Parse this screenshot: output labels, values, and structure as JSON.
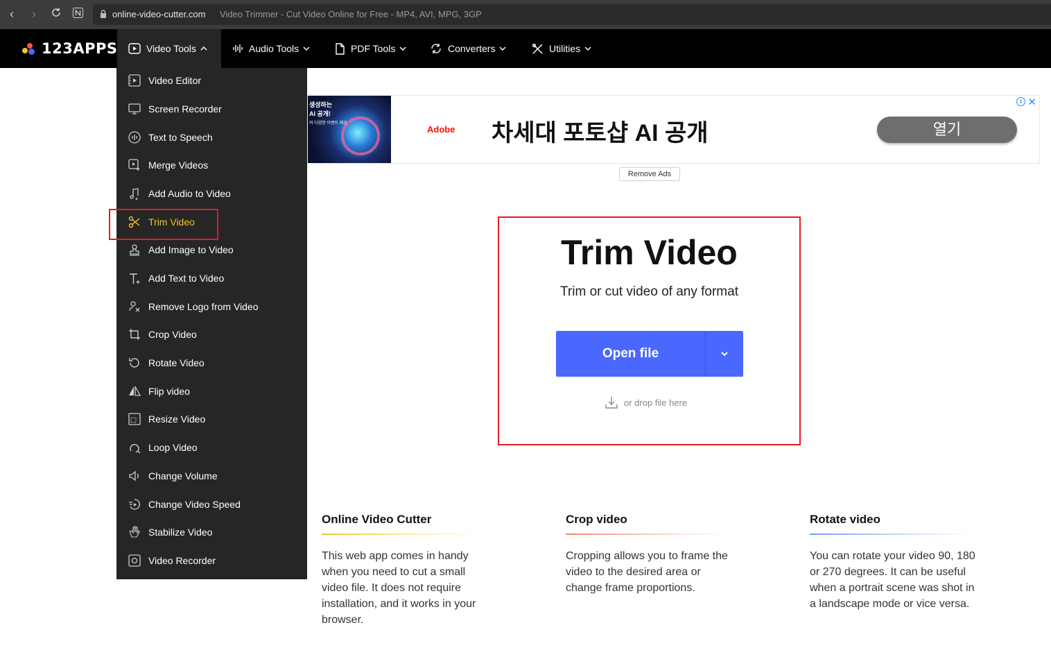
{
  "browser": {
    "host": "online-video-cutter.com",
    "page_title": "Video Trimmer - Cut Video Online for Free - MP4, AVI, MPG, 3GP"
  },
  "logo": {
    "text": "123APPS"
  },
  "nav": {
    "video_tools": "Video Tools",
    "audio_tools": "Audio Tools",
    "pdf_tools": "PDF Tools",
    "converters": "Converters",
    "utilities": "Utilities"
  },
  "menu": {
    "items": [
      {
        "label": "Video Editor",
        "icon": "video-editor-icon"
      },
      {
        "label": "Screen Recorder",
        "icon": "monitor-icon"
      },
      {
        "label": "Text to Speech",
        "icon": "speech-icon"
      },
      {
        "label": "Merge Videos",
        "icon": "merge-icon"
      },
      {
        "label": "Add Audio to Video",
        "icon": "music-note-icon"
      },
      {
        "label": "Trim Video",
        "icon": "scissors-icon",
        "selected": true
      },
      {
        "label": "Add Image to Video",
        "icon": "stamp-icon"
      },
      {
        "label": "Add Text to Video",
        "icon": "text-icon"
      },
      {
        "label": "Remove Logo from Video",
        "icon": "remove-logo-icon"
      },
      {
        "label": "Crop Video",
        "icon": "crop-icon"
      },
      {
        "label": "Rotate Video",
        "icon": "rotate-icon"
      },
      {
        "label": "Flip video",
        "icon": "flip-icon"
      },
      {
        "label": "Resize Video",
        "icon": "resize-icon"
      },
      {
        "label": "Loop Video",
        "icon": "loop-icon"
      },
      {
        "label": "Change Volume",
        "icon": "volume-icon"
      },
      {
        "label": "Change Video Speed",
        "icon": "speed-icon"
      },
      {
        "label": "Stabilize Video",
        "icon": "stabilize-icon"
      },
      {
        "label": "Video Recorder",
        "icon": "record-icon"
      }
    ]
  },
  "ad": {
    "thumb_line1": "생성하는",
    "thumb_line2": "AI 공개!",
    "thumb_line3": "의 다양한 이벤트 제공",
    "brand": "Adobe",
    "headline": "차세대 포토샵 AI 공개",
    "cta": "열기",
    "info": "i",
    "close": "✕",
    "remove_ads": "Remove Ads"
  },
  "main": {
    "title": "Trim Video",
    "subtitle": "Trim or cut video of any format",
    "open_file": "Open file",
    "drop_hint": "or drop file here"
  },
  "features": [
    {
      "title": "Online Video Cutter",
      "text": "This web app comes in handy when you need to cut a small video file. It does not require installation, and it works in your browser.",
      "accent": "#f4c430"
    },
    {
      "title": "Crop video",
      "text": "Cropping allows you to frame the video to the desired area or change frame proportions.",
      "accent": "#f08a6a"
    },
    {
      "title": "Rotate video",
      "text": "You can rotate your video 90, 180 or 270 degrees. It can be useful when a portrait scene was shot in a landscape mode or vice versa.",
      "accent": "#6f9ef5"
    }
  ],
  "colors": {
    "accent_blue": "#4a68fd",
    "selected_yellow": "#f4c430",
    "highlight_red": "#e31b23"
  }
}
